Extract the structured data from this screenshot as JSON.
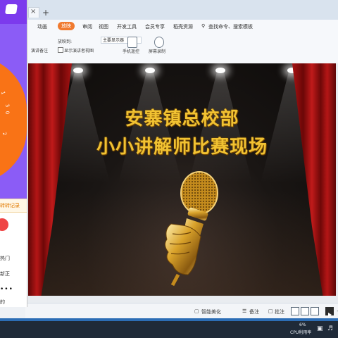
{
  "tabs": {
    "close_glyph": "×",
    "add_glyph": "+"
  },
  "menu": {
    "items": [
      "动画",
      "放映",
      "审阅",
      "视图",
      "开发工具",
      "会员专享",
      "稻壳资源"
    ],
    "active": "放映",
    "search": "查找命令、搜索模板"
  },
  "ribbon": {
    "device_label": "放映到:",
    "device_value": "主要显示器",
    "rehearse": "演讲备注",
    "presenter_view": "显示演讲者视图",
    "phone_remote": "手机遥控",
    "screen_record": "屏幕录制"
  },
  "slide": {
    "title_line1": "安寨镇总校部",
    "title_line2": "小小讲解师比赛现场"
  },
  "statusbar": {
    "smart_beautify": "智能美化",
    "notes": "备注",
    "comments": "批注"
  },
  "overlay": {
    "spin_record": "转转记录",
    "hot": "热门",
    "latest": "新正",
    "dots": "•••",
    "bottom": "的",
    "wheel_numbers": [
      "1",
      "3",
      "0",
      "2"
    ]
  },
  "taskbar": {
    "cpu_percent": "6%",
    "cpu_label": "CPU利用率"
  },
  "colors": {
    "accent_orange": "#f07a2f",
    "overlay_purple": "#8b5cf6",
    "title_gold": "#f1c232",
    "curtain_red": "#b51616"
  }
}
